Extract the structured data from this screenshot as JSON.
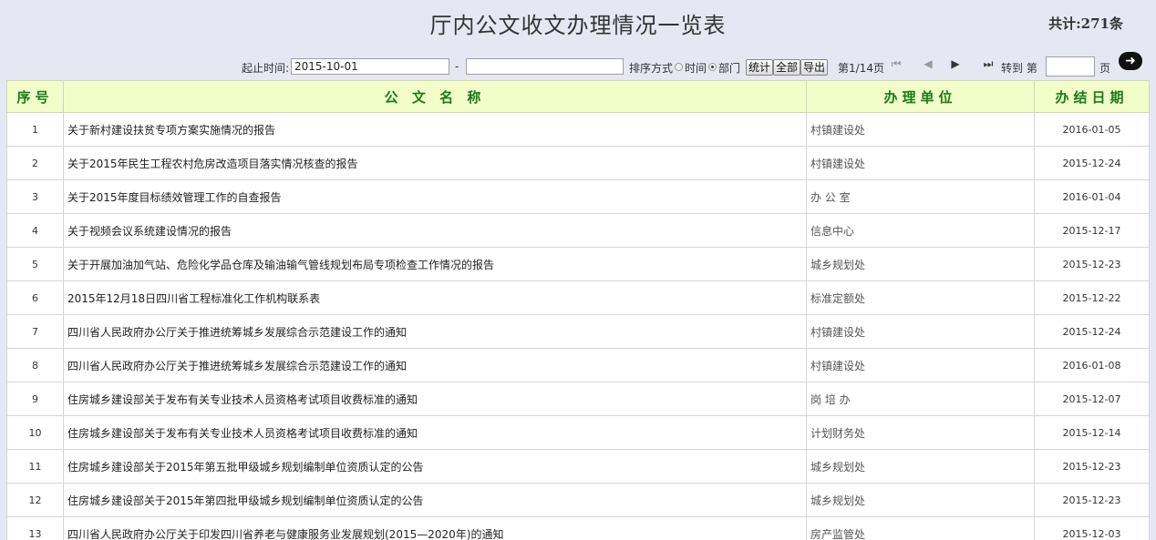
{
  "title": "厅内公文收文办理情况一览表",
  "total": "共计:271条",
  "toolbar": {
    "date_label": "起止时间:",
    "start_date": "2015-10-01",
    "separator": "-",
    "end_date": "",
    "sort_label": "排序方式",
    "sort_options": [
      {
        "label": "时间",
        "selected": false
      },
      {
        "label": "部门",
        "selected": true
      }
    ],
    "buttons": {
      "stats": "统计",
      "all": "全部",
      "export": "导出"
    },
    "page_info": "第1/14页",
    "goto_label": "转到 第",
    "goto_value": "",
    "page_suffix": "页",
    "go_icon": "arrow-right-circle-icon"
  },
  "table": {
    "headers": [
      "序号",
      "公 文 名 称",
      "办理单位",
      "办结日期"
    ],
    "rows": [
      {
        "no": "1",
        "name": "关于新村建设扶贫专项方案实施情况的报告",
        "dept": "村镇建设处",
        "date": "2016-01-05"
      },
      {
        "no": "2",
        "name": "关于2015年民生工程农村危房改造项目落实情况核查的报告",
        "dept": "村镇建设处",
        "date": "2015-12-24"
      },
      {
        "no": "3",
        "name": "关于2015年度目标绩效管理工作的自查报告",
        "dept": "办 公 室",
        "date": "2016-01-04"
      },
      {
        "no": "4",
        "name": "关于视频会议系统建设情况的报告",
        "dept": "信息中心",
        "date": "2015-12-17"
      },
      {
        "no": "5",
        "name": "关于开展加油加气站、危险化学品仓库及输油输气管线规划布局专项检查工作情况的报告",
        "dept": "城乡规划处",
        "date": "2015-12-23"
      },
      {
        "no": "6",
        "name": "2015年12月18日四川省工程标准化工作机构联系表",
        "dept": "标准定额处",
        "date": "2015-12-22"
      },
      {
        "no": "7",
        "name": "四川省人民政府办公厅关于推进统筹城乡发展综合示范建设工作的通知",
        "dept": "村镇建设处",
        "date": "2015-12-24"
      },
      {
        "no": "8",
        "name": "四川省人民政府办公厅关于推进统筹城乡发展综合示范建设工作的通知",
        "dept": "村镇建设处",
        "date": "2016-01-08"
      },
      {
        "no": "9",
        "name": "住房城乡建设部关于发布有关专业技术人员资格考试项目收费标准的通知",
        "dept": "岗 培 办",
        "date": "2015-12-07"
      },
      {
        "no": "10",
        "name": "住房城乡建设部关于发布有关专业技术人员资格考试项目收费标准的通知",
        "dept": "计划财务处",
        "date": "2015-12-14"
      },
      {
        "no": "11",
        "name": "住房城乡建设部关于2015年第五批甲级城乡规划编制单位资质认定的公告",
        "dept": "城乡规划处",
        "date": "2015-12-23"
      },
      {
        "no": "12",
        "name": "住房城乡建设部关于2015年第四批甲级城乡规划编制单位资质认定的公告",
        "dept": "城乡规划处",
        "date": "2015-12-23"
      },
      {
        "no": "13",
        "name": "四川省人民政府办公厅关于印发四川省养老与健康服务业发展规划(2015—2020年)的通知",
        "dept": "房产监管处",
        "date": "2015-12-03"
      }
    ]
  }
}
